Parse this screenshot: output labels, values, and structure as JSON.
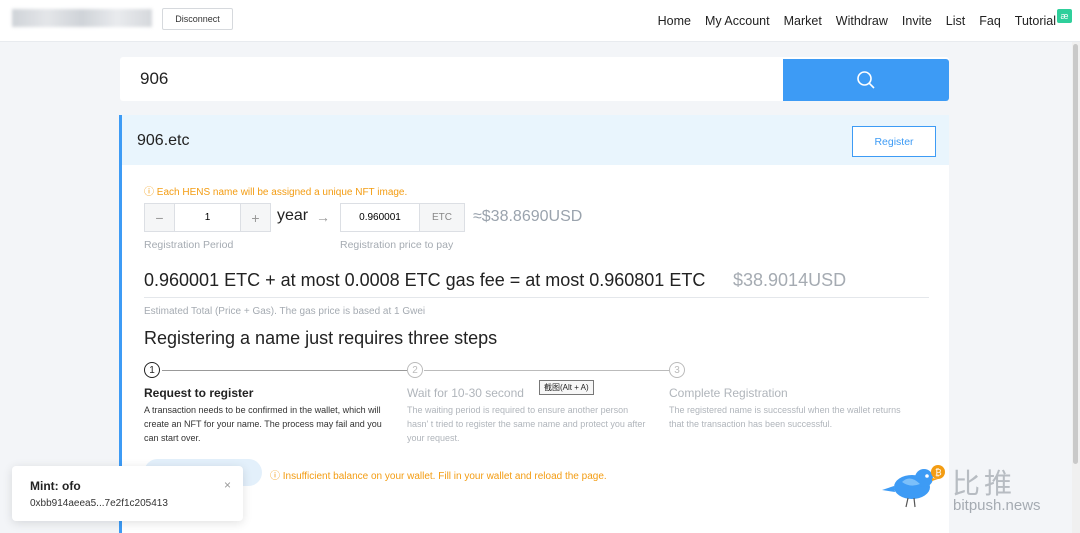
{
  "header": {
    "disconnect_label": "Disconnect",
    "nav": [
      "Home",
      "My Account",
      "Market",
      "Withdraw",
      "Invite",
      "List",
      "Faq",
      "Tutorial"
    ],
    "tutorial_badge": "æ"
  },
  "search": {
    "value": "906",
    "button_icon": "search-icon"
  },
  "result": {
    "domain": "906.etc",
    "register_label": "Register",
    "nft_notice": "ⓘ Each HENS name will be assigned a unique NFT image.",
    "period_value": "1",
    "minus": "−",
    "plus": "+",
    "year_label": "year",
    "arrow": "→",
    "price_value": "0.960001",
    "price_unit": "ETC",
    "price_usd": "≈$38.8690USD",
    "period_label": "Registration Period",
    "price_label": "Registration price to pay",
    "total": "0.960001 ETC + at most 0.0008 ETC gas fee = at most 0.960801 ETC",
    "total_usd": "$38.9014USD",
    "estimated_note": "Estimated Total (Price + Gas). The gas price is based at 1 Gwei",
    "steps_title": "Registering a name just requires three steps",
    "steps": [
      {
        "num": "1",
        "title": "Request to register",
        "desc": "A transaction needs to be confirmed in the wallet, which will create an NFT for your name. The process may fail and you can start over."
      },
      {
        "num": "2",
        "title": "Wait for 10-30 second",
        "desc": "The waiting period is required to ensure another person hasn' t tried to register the same name and protect you after your request."
      },
      {
        "num": "3",
        "title": "Complete Registration",
        "desc": "The registered name is successful when the wallet returns that the transaction has been successful."
      }
    ],
    "tooltip": "截图(Alt + A)",
    "balance_warning": "ⓘ Insufficient balance on your wallet. Fill in your wallet and reload the page."
  },
  "toast": {
    "title": "Mint:  ofo",
    "hash": "0xbb914aeea5...7e2f1c205413",
    "close": "×"
  },
  "watermark": {
    "text": "比推",
    "url": "bitpush.news"
  },
  "colors": {
    "accent": "#3d9bf5",
    "warning": "#f39c12",
    "muted": "#a5abb2"
  }
}
